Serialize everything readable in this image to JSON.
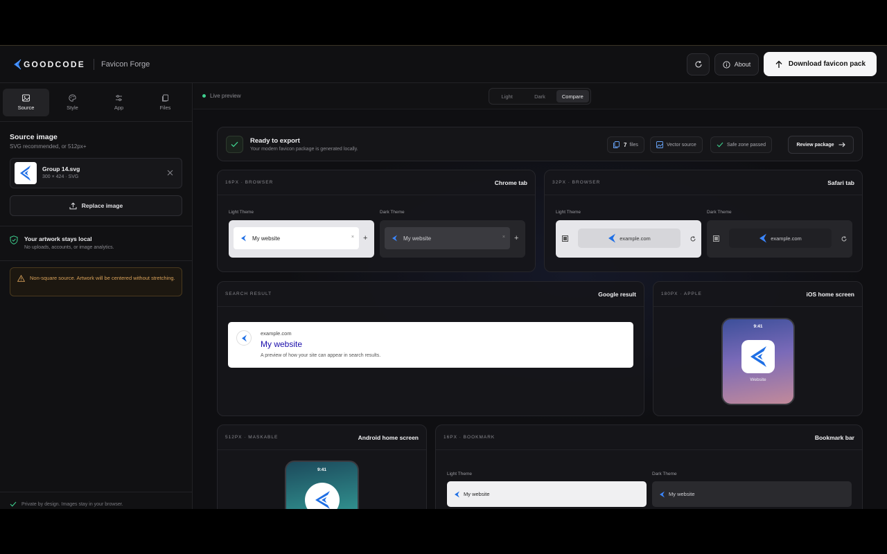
{
  "header": {
    "brand": "GOODCODE",
    "app_name": "Favicon Forge",
    "about_label": "About",
    "download_label": "Download favicon pack",
    "refresh_icon": "refresh-icon"
  },
  "sidebar": {
    "tabs": [
      {
        "label": "Source",
        "icon": "image-icon",
        "active": true
      },
      {
        "label": "Style",
        "icon": "palette-icon",
        "active": false
      },
      {
        "label": "App",
        "icon": "sliders-icon",
        "active": false
      },
      {
        "label": "Files",
        "icon": "files-icon",
        "active": false
      }
    ],
    "source_title": "Source image",
    "source_sub": "SVG recommended, or 512px+",
    "file": {
      "name": "Group 14.svg",
      "meta": "300 × 424 · SVG"
    },
    "replace_label": "Replace image",
    "local_title": "Your artwork stays local",
    "local_sub": "No uploads, accounts, or image analytics.",
    "warning": "Non-square source. Artwork will be centered without stretching.",
    "footer": "Private by design. Images stay in your browser."
  },
  "toolbar": {
    "live_label": "Live preview",
    "modes": [
      "Light",
      "Dark",
      "Compare"
    ],
    "active_mode": "Compare"
  },
  "ready": {
    "title": "Ready to export",
    "sub": "Your modern favicon package is generated locally.",
    "files_count": "7",
    "files_label": "files",
    "vector_label": "Vector source",
    "safe_label": "Safe zone passed",
    "review_label": "Review package"
  },
  "cards": {
    "chrome": {
      "cap": "16PX · BROWSER",
      "title": "Chrome tab",
      "light": "Light Theme",
      "dark": "Dark Theme",
      "tab_text": "My website",
      "close": "×",
      "plus": "+"
    },
    "safari": {
      "cap": "32PX · BROWSER",
      "title": "Safari tab",
      "light": "Light Theme",
      "dark": "Dark Theme",
      "url": "example.com"
    },
    "google": {
      "cap": "SEARCH RESULT",
      "title": "Google result",
      "site": "example.com",
      "page_title": "My website",
      "desc": "A preview of how your site can appear in search results."
    },
    "ios": {
      "cap": "180PX · APPLE",
      "title": "iOS home screen",
      "time": "9:41",
      "app_label": "Website"
    },
    "android": {
      "cap": "512PX · MASKABLE",
      "title": "Android home screen",
      "time": "9:41"
    },
    "bookmark": {
      "cap": "16PX · BOOKMARK",
      "title": "Bookmark bar",
      "light": "Light Theme",
      "dark": "Dark Theme",
      "text": "My website"
    }
  },
  "colors": {
    "accent_blue": "#1f6fe5",
    "success": "#3ecf8e",
    "warning": "#d9a25a"
  }
}
